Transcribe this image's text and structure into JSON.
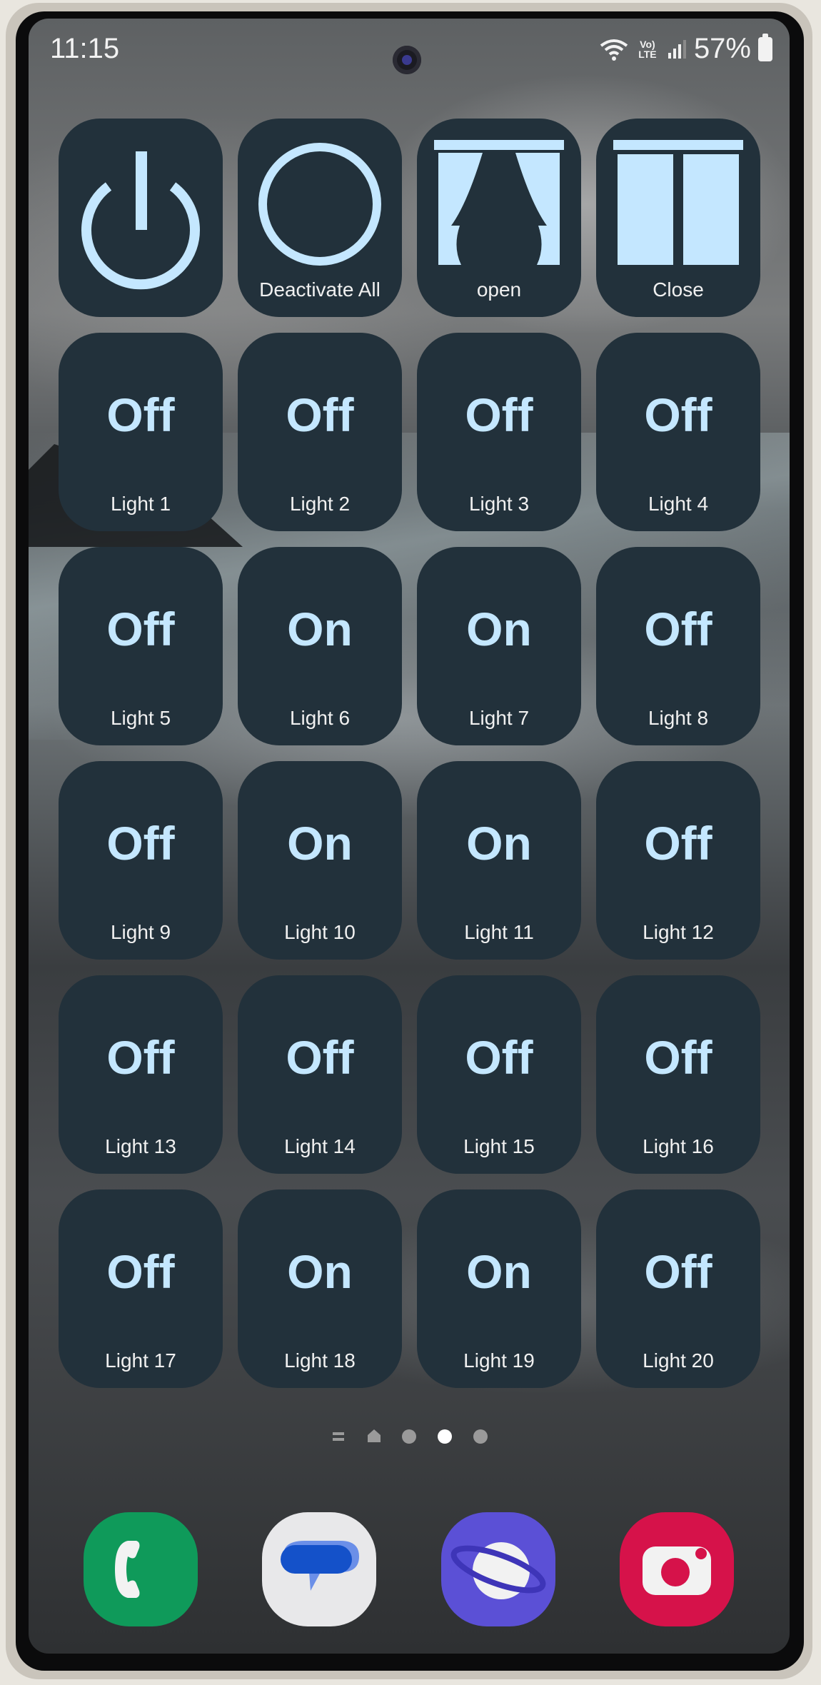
{
  "status_bar": {
    "time": "11:15",
    "volte": "Vo) LTE",
    "battery": "57%"
  },
  "action_tiles": [
    {
      "id": "power",
      "label": "",
      "icon": "power-icon"
    },
    {
      "id": "deactivate",
      "label": "Deactivate All",
      "icon": "circle-icon"
    },
    {
      "id": "open",
      "label": "open",
      "icon": "curtains-open-icon"
    },
    {
      "id": "close",
      "label": "Close",
      "icon": "curtains-closed-icon"
    }
  ],
  "lights": [
    {
      "label": "Light 1",
      "state": "Off"
    },
    {
      "label": "Light 2",
      "state": "Off"
    },
    {
      "label": "Light 3",
      "state": "Off"
    },
    {
      "label": "Light 4",
      "state": "Off"
    },
    {
      "label": "Light 5",
      "state": "Off"
    },
    {
      "label": "Light 6",
      "state": "On"
    },
    {
      "label": "Light 7",
      "state": "On"
    },
    {
      "label": "Light 8",
      "state": "Off"
    },
    {
      "label": "Light 9",
      "state": "Off"
    },
    {
      "label": "Light 10",
      "state": "On"
    },
    {
      "label": "Light 11",
      "state": "On"
    },
    {
      "label": "Light 12",
      "state": "Off"
    },
    {
      "label": "Light 13",
      "state": "Off"
    },
    {
      "label": "Light 14",
      "state": "Off"
    },
    {
      "label": "Light 15",
      "state": "Off"
    },
    {
      "label": "Light 16",
      "state": "Off"
    },
    {
      "label": "Light 17",
      "state": "Off"
    },
    {
      "label": "Light 18",
      "state": "On"
    },
    {
      "label": "Light 19",
      "state": "On"
    },
    {
      "label": "Light 20",
      "state": "Off"
    }
  ],
  "page_indicator": {
    "pages": 5,
    "current": 3
  },
  "dock": [
    {
      "name": "phone",
      "icon": "phone-icon",
      "color": "#0f9a5a"
    },
    {
      "name": "messages",
      "icon": "chat-bubble-icon",
      "color": "#e8e8ea"
    },
    {
      "name": "internet",
      "icon": "planet-icon",
      "color": "#5b50d6"
    },
    {
      "name": "camera",
      "icon": "camera-icon",
      "color": "#d6124a"
    }
  ],
  "colors": {
    "tile_bg": "#22313b",
    "tile_accent": "#c4e7ff"
  }
}
